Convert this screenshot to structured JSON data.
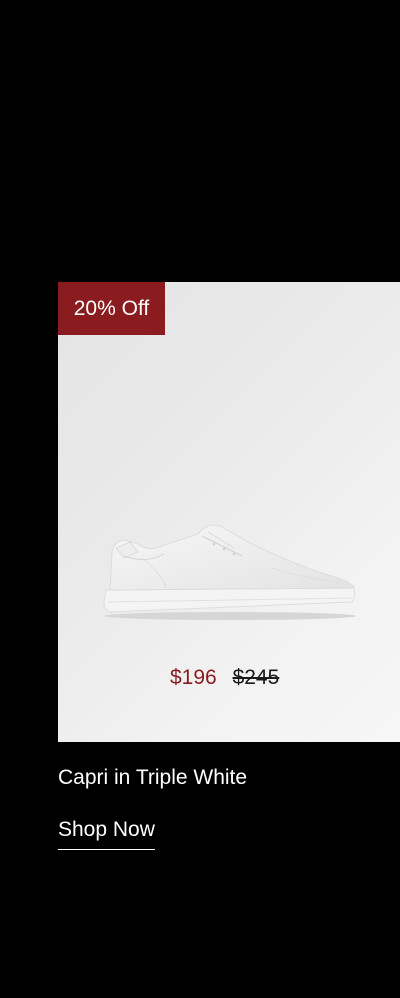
{
  "product": {
    "badge": "20% Off",
    "image_alt": "White low-top leather sneaker",
    "sale_price": "$196",
    "original_price": "$245",
    "name": "Capri in Triple White",
    "cta": "Shop Now"
  },
  "colors": {
    "page_background": "#000000",
    "badge_background": "#8a1c1f",
    "sale_price": "#8a1c1f",
    "image_background": "#ececec"
  }
}
